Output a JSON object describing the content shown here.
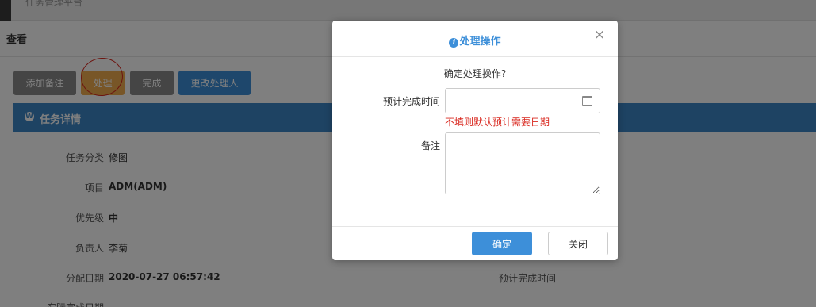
{
  "topbar": {
    "crumb": "任务管理平台"
  },
  "panel": {
    "title": "查看"
  },
  "toolbar": {
    "add_note": "添加备注",
    "handle": "处理",
    "done": "完成",
    "change_handler": "更改处理人"
  },
  "section": {
    "icon_glyph": "W",
    "title": "任务详情"
  },
  "details": {
    "category_label": "任务分类",
    "category_value": "修图",
    "project_label": "项目",
    "project_value": "ADM(ADM)",
    "priority_label": "优先级",
    "priority_value": "中",
    "owner_label": "负责人",
    "owner_value": "李菊",
    "assign_date_label": "分配日期",
    "assign_date_value": "2020-07-27 06:57:42",
    "expected_label": "预计完成时间",
    "actual_label": "实际完成日期"
  },
  "modal": {
    "title": "处理操作",
    "info_glyph": "i",
    "close_glyph": "×",
    "confirm_text": "确定处理操作?",
    "date_label": "预计完成时间",
    "date_value": "",
    "date_placeholder": "",
    "hint": "不填则默认预计需要日期",
    "remark_label": "备注",
    "remark_value": "",
    "ok_label": "确定",
    "cancel_label": "关闭"
  },
  "colors": {
    "primary": "#3d8fd9",
    "warning": "#f0ad4e",
    "danger": "#d9281f",
    "gray_button": "#8a8a8a",
    "section_bar": "#3d86c6"
  },
  "icons": [
    "info-icon",
    "close-icon",
    "calendar-icon",
    "wordpress-icon"
  ]
}
